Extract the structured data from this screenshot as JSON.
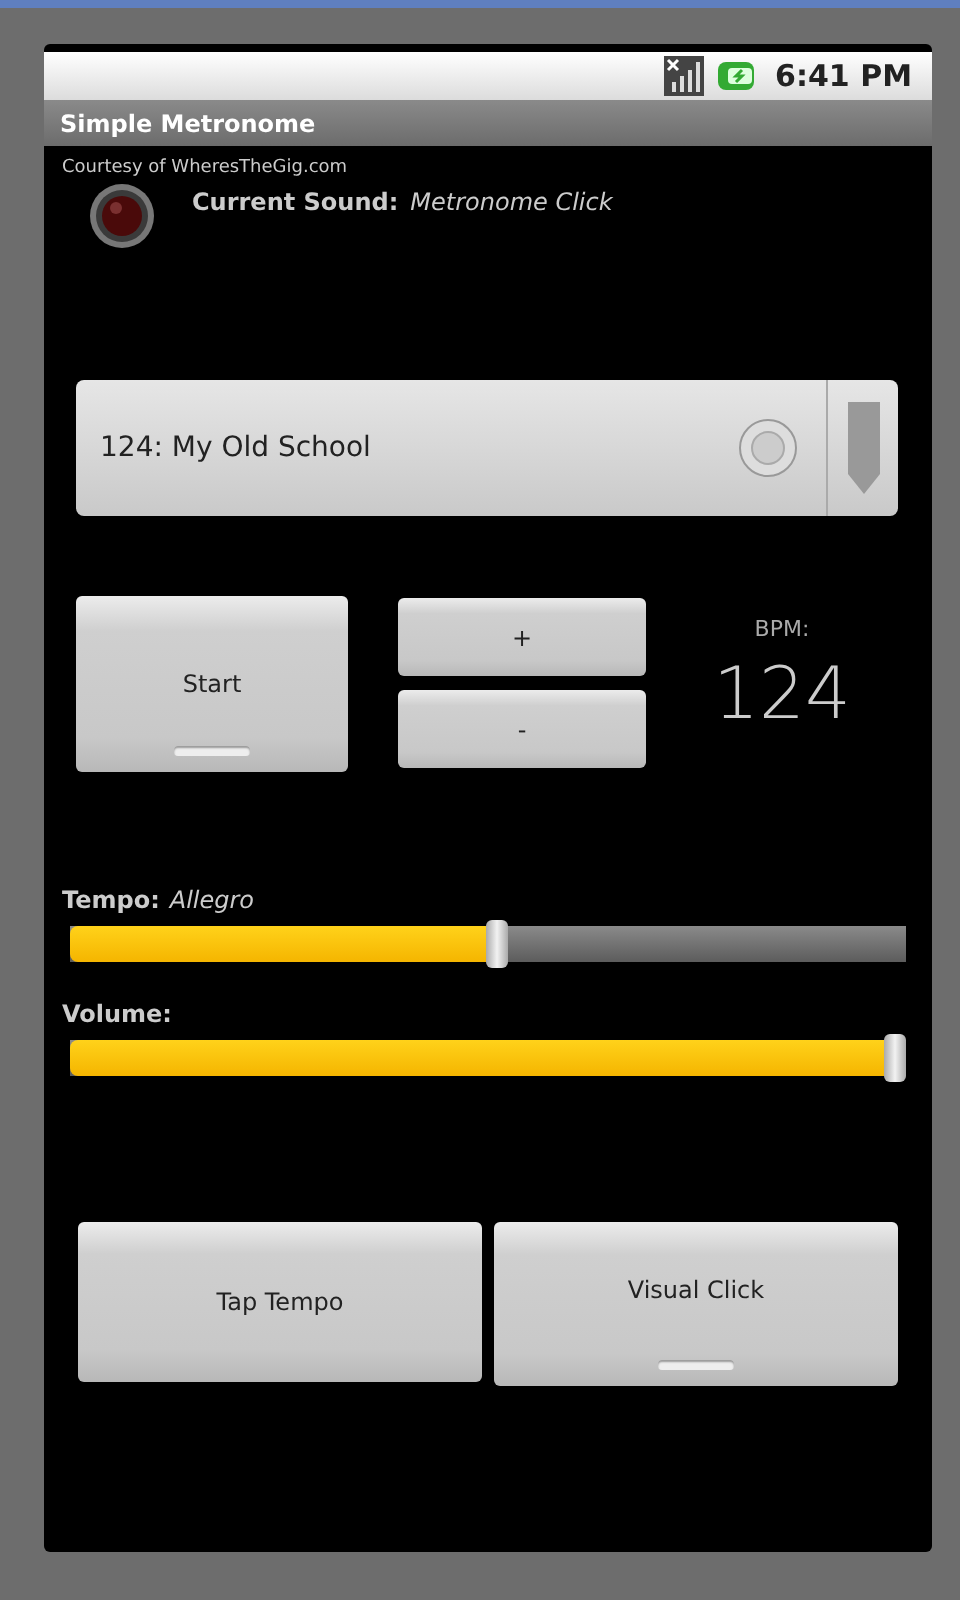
{
  "status_bar": {
    "time": "6:41 PM"
  },
  "title_bar": {
    "title": "Simple Metronome"
  },
  "courtesy": "Courtesy of WheresTheGig.com",
  "current_sound": {
    "label": "Current Sound:",
    "value": "Metronome Click"
  },
  "preset_spinner": {
    "value": "124: My Old School"
  },
  "start_button": {
    "label": "Start",
    "on": false
  },
  "step_buttons": [
    "+",
    "-"
  ],
  "bpm": {
    "label": "BPM:",
    "value": "124"
  },
  "sliders": [
    {
      "label": "Tempo:",
      "value": "Allegro",
      "level": 0.51
    },
    {
      "label": "Volume:",
      "level": 1
    }
  ],
  "bottom_buttons": [
    {
      "label": "Tap Tempo",
      "kind": "plain"
    },
    {
      "label": "Visual Click",
      "kind": "toggle",
      "on": false
    }
  ]
}
